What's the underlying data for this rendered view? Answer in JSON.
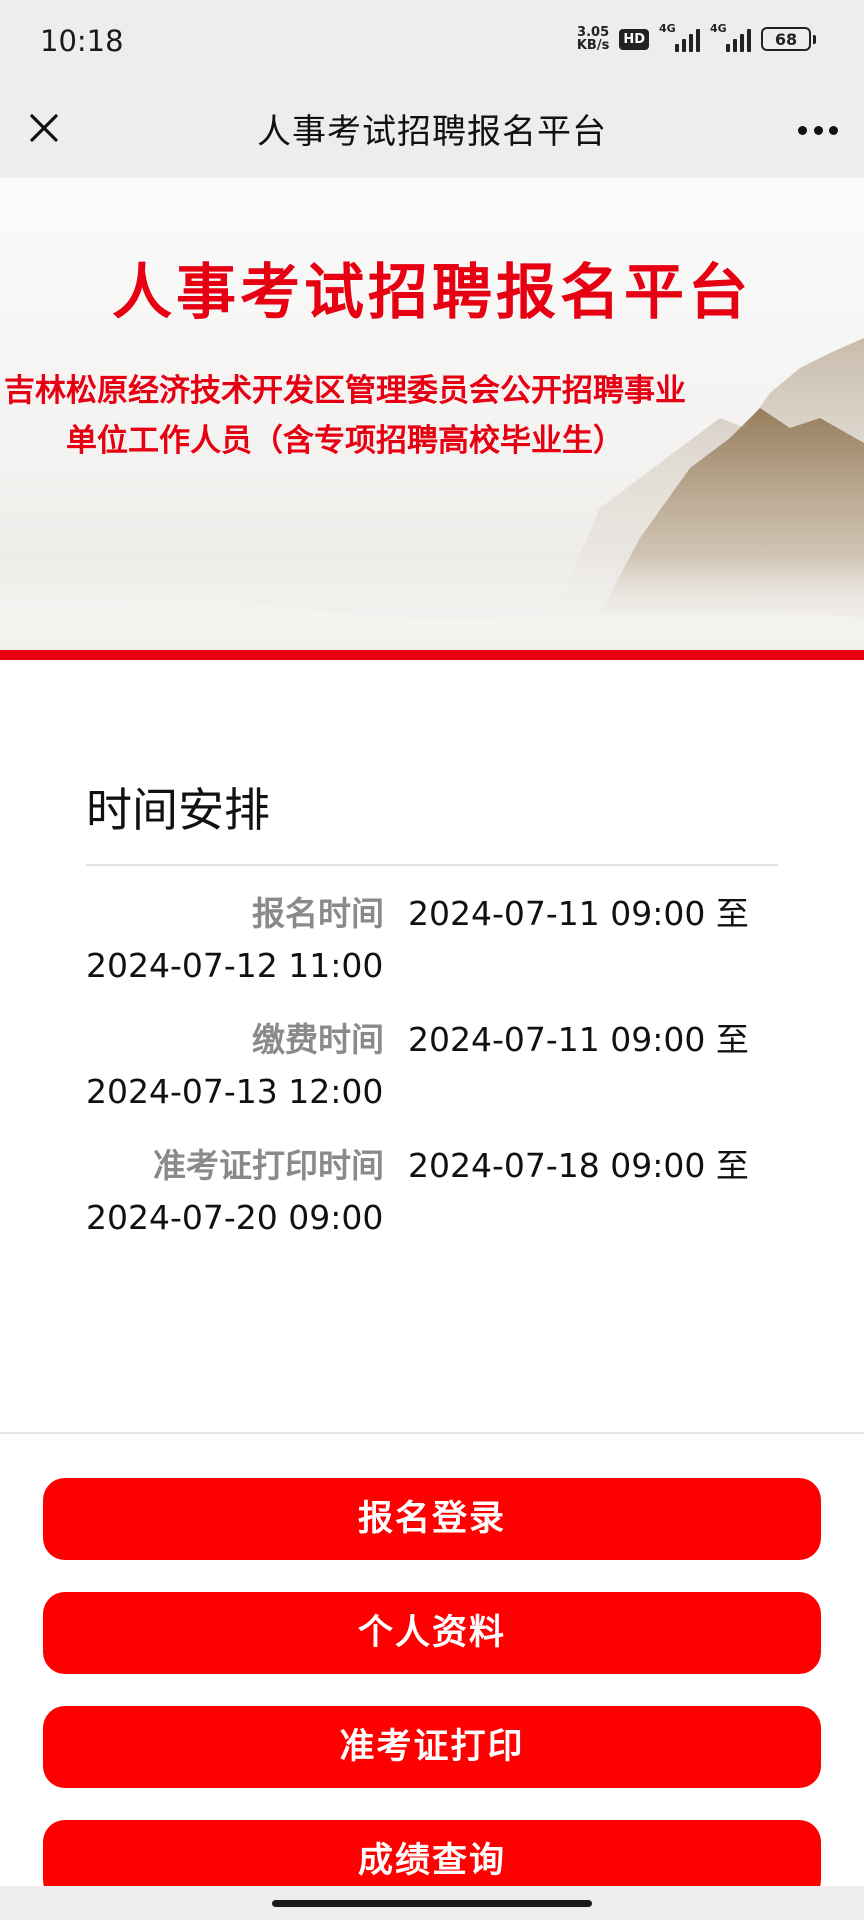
{
  "status_bar": {
    "time": "10:18",
    "net_speed_value": "3.05",
    "net_speed_unit": "KB/s",
    "hd_badge": "HD",
    "signal1_label": "4G",
    "signal2_label": "4G",
    "battery": "68"
  },
  "nav": {
    "title": "人事考试招聘报名平台",
    "close_icon": "close-icon",
    "more_icon": "more-icon"
  },
  "banner": {
    "title": "人事考试招聘报名平台",
    "subtitle": "吉林松原经济技术开发区管理委员会公开招聘事业单位工作人员（含专项招聘高校毕业生）",
    "accent_color": "#e60012"
  },
  "schedule": {
    "title": "时间安排",
    "items": [
      {
        "label": "报名时间",
        "start": "2024-07-11 09:00 至",
        "end": "2024-07-12 11:00"
      },
      {
        "label": "缴费时间",
        "start": "2024-07-11 09:00 至",
        "end": "2024-07-13 12:00"
      },
      {
        "label": "准考证打印时间",
        "start": "2024-07-18 09:00 至",
        "end": "2024-07-20 09:00"
      }
    ]
  },
  "buttons": [
    {
      "label": "报名登录"
    },
    {
      "label": "个人资料"
    },
    {
      "label": "准考证打印"
    },
    {
      "label": "成绩查询"
    }
  ],
  "button_color": "#ff0000"
}
